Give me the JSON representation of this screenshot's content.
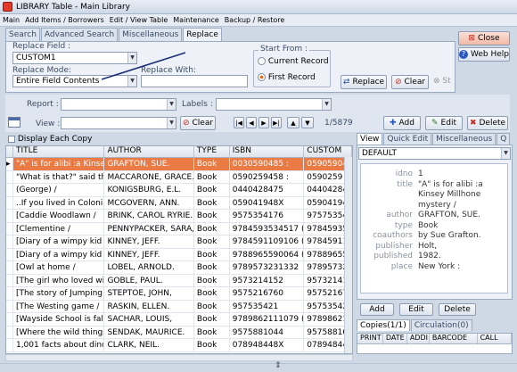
{
  "window": {
    "title": "LIBRARY Table - Main Library"
  },
  "menu": [
    "Main",
    "Add Items / Borrowers",
    "Edit / View Table",
    "Maintenance",
    "Backup / Restore"
  ],
  "tabs": [
    "Search",
    "Advanced Search",
    "Miscellaneous",
    "Replace"
  ],
  "replace": {
    "replace_field_label": "Replace Field :",
    "replace_field_value": "CUSTOM1",
    "replace_mode_label": "Replace Mode:",
    "replace_mode_value": "Entire Field Contents",
    "replace_with_label": "Replace With:",
    "replace_with_value": "",
    "start_from_label": "Start From :",
    "current_record": "Current Record",
    "first_record": "First Record",
    "replace_btn": "Replace",
    "clear_btn": "Clear",
    "st_btn": "St"
  },
  "right_buttons": {
    "close": "Close",
    "web_help": "Web Help"
  },
  "filters": {
    "report_label": "Report :",
    "labels_label": "Labels :",
    "view_label": "View :",
    "clear_btn": "Clear",
    "record_count": "1/5879"
  },
  "actions": {
    "add": "Add",
    "edit": "Edit",
    "delete": "Delete"
  },
  "display_each_copy": "Display Each Copy",
  "grid": {
    "columns": [
      "TITLE",
      "AUTHOR",
      "TYPE",
      "ISBN",
      "CUSTOM"
    ],
    "rows": [
      [
        "\"A\" is for alibi :a Kinsey M",
        "GRAFTON, SUE.",
        "Book",
        "0030590485 :",
        "05905904"
      ],
      [
        "\"What is that?\" said the c",
        "MACCARONE, GRACE.",
        "Book",
        "0590259458 :",
        "0590259"
      ],
      [
        "(George) /",
        "KONIGSBURG, E.L.",
        "Book",
        "0440428475",
        "04404284"
      ],
      [
        "..If you lived in Colonial ti",
        "MCGOVERN, ANN.",
        "Book",
        "059041948X",
        "05904194"
      ],
      [
        "[Caddie Woodlawn /",
        "BRINK, CAROL RYRIE.",
        "Book",
        "9575354176",
        "97575354"
      ],
      [
        "[Clementine /",
        "PENNYPACKER, SARA,",
        "Book",
        "9784593534517 (tra",
        "97845935"
      ],
      [
        "[Diary of a wimpy kid :th",
        "KINNEY, JEFF.",
        "Book",
        "9784591109106 (tra",
        "97845911"
      ],
      [
        "[Diary of a wimpy kid :th",
        "KINNEY, JEFF.",
        "Book",
        "9788965590064 (tra",
        "97889655"
      ],
      [
        "[Owl at home /",
        "LOBEL, ARNOLD.",
        "Book",
        "9789573231332",
        "97895732"
      ],
      [
        "[The girl who loved wild h",
        "GOBLE, PAUL.",
        "Book",
        "9573214152",
        "95732141"
      ],
      [
        "[The story of Jumping M",
        "STEPTOE, JOHN,",
        "Book",
        "9575216760",
        "95752167"
      ],
      [
        "[The Westing game /",
        "RASKIN, ELLEN.",
        "Book",
        "957535421",
        "95753542"
      ],
      [
        "[Wayside School is falling",
        "SACHAR, LOUIS,",
        "Book",
        "9789862111079 (pb",
        "97898621"
      ],
      [
        "[Where the wild things ar",
        "SENDAK, MAURICE.",
        "Book",
        "9575881044",
        "95758810"
      ],
      [
        "1,001 facts about dinosa",
        "CLARK, NEIL.",
        "Book",
        "078948448X",
        "07894844"
      ]
    ]
  },
  "right_panel": {
    "tabs": [
      "View",
      "Quick Edit",
      "Miscellaneous",
      "Q"
    ],
    "layout_value": "DEFAULT",
    "details": [
      {
        "k": "idno",
        "v": "1"
      },
      {
        "k": "title",
        "v": "\"A\" is for alibi :a"
      },
      {
        "k": "",
        "v": "Kinsey Millhone"
      },
      {
        "k": "",
        "v": "mystery /"
      },
      {
        "k": "author",
        "v": "GRAFTON, SUE."
      },
      {
        "k": "type",
        "v": "Book"
      },
      {
        "k": "coauthors",
        "v": "by Sue Grafton."
      },
      {
        "k": "publisher",
        "v": "Holt,"
      },
      {
        "k": "published",
        "v": "1982."
      },
      {
        "k": "place",
        "v": "New York :"
      }
    ],
    "buttons": {
      "add": "Add",
      "edit": "Edit",
      "delete": "Delete"
    },
    "bottom_tabs": [
      "Copies(1/1)",
      "Circulation(0)"
    ],
    "copy_columns": [
      "PRINT",
      "DATE",
      "ADDI",
      "BARCODE",
      "CALL"
    ]
  }
}
